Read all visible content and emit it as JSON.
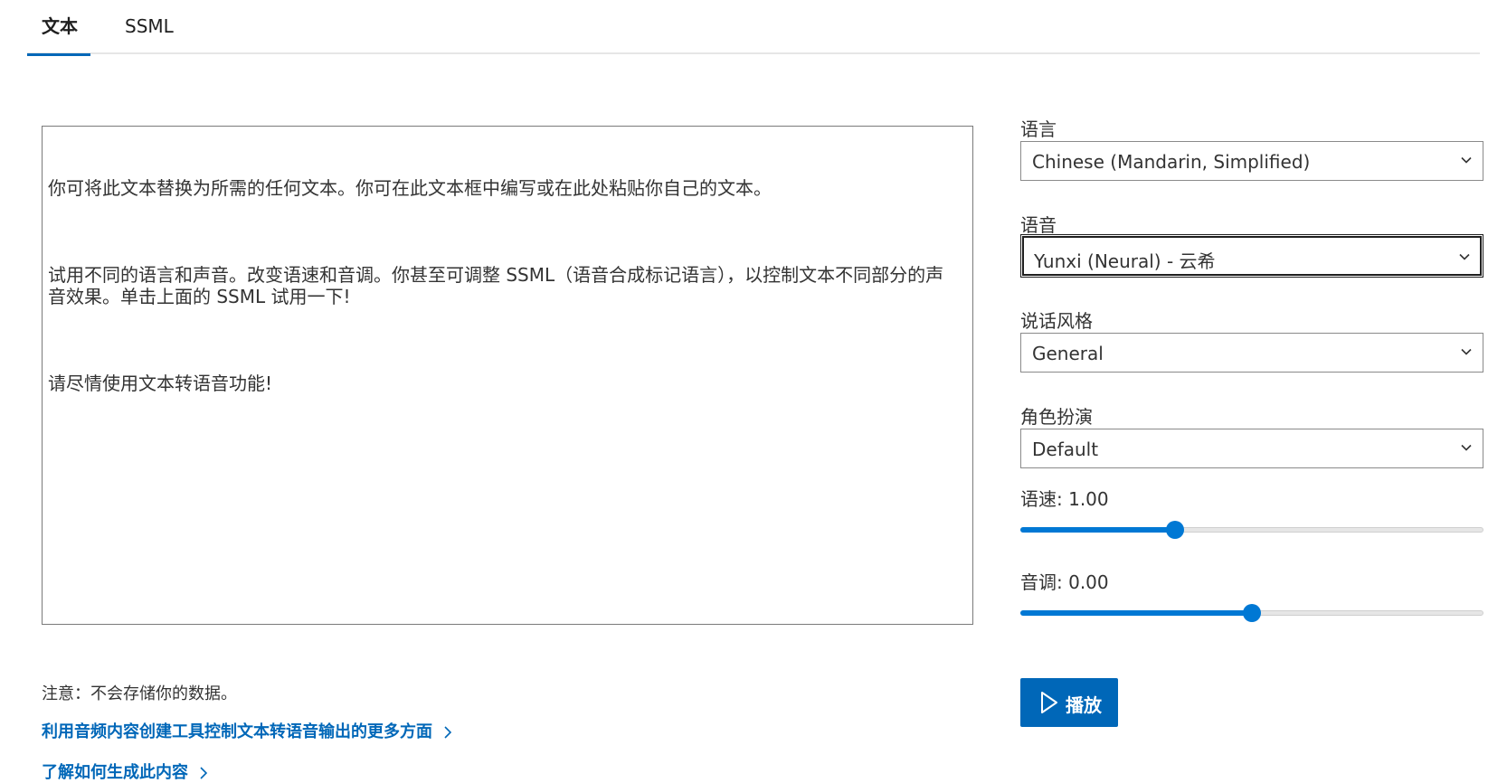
{
  "tabs": {
    "items": [
      {
        "label": "文本",
        "active": true
      },
      {
        "label": "SSML",
        "active": false
      }
    ]
  },
  "text_input": {
    "paragraphs": [
      "你可将此文本替换为所需的任何文本。你可在此文本框中编写或在此处粘贴你自己的文本。",
      "试用不同的语言和声音。改变语速和音调。你甚至可调整 SSML（语音合成标记语言），以控制文本不同部分的声音效果。单击上面的 SSML 试用一下!",
      "请尽情使用文本转语音功能!"
    ]
  },
  "settings": {
    "language": {
      "label": "语言",
      "value": "Chinese (Mandarin, Simplified)"
    },
    "voice": {
      "label": "语音",
      "value": "Yunxi (Neural) - 云希"
    },
    "style": {
      "label": "说话风格",
      "value": "General"
    },
    "role": {
      "label": "角色扮演",
      "value": "Default"
    },
    "rate": {
      "label": "语速: 1.00",
      "value": 1.0,
      "min": 0,
      "max": 3
    },
    "pitch": {
      "label": "音调: 0.00",
      "value": 0.0,
      "min": -0.5,
      "max": 0.5
    }
  },
  "play_button": {
    "label": "播放",
    "icon": "play-icon"
  },
  "notes": {
    "privacy": "注意：不会存储你的数据。",
    "link1": "利用音频内容创建工具控制文本转语音输出的更多方面",
    "link2": "了解如何生成此内容"
  },
  "colors": {
    "accent": "#0067b8",
    "slider": "#0078d4"
  }
}
